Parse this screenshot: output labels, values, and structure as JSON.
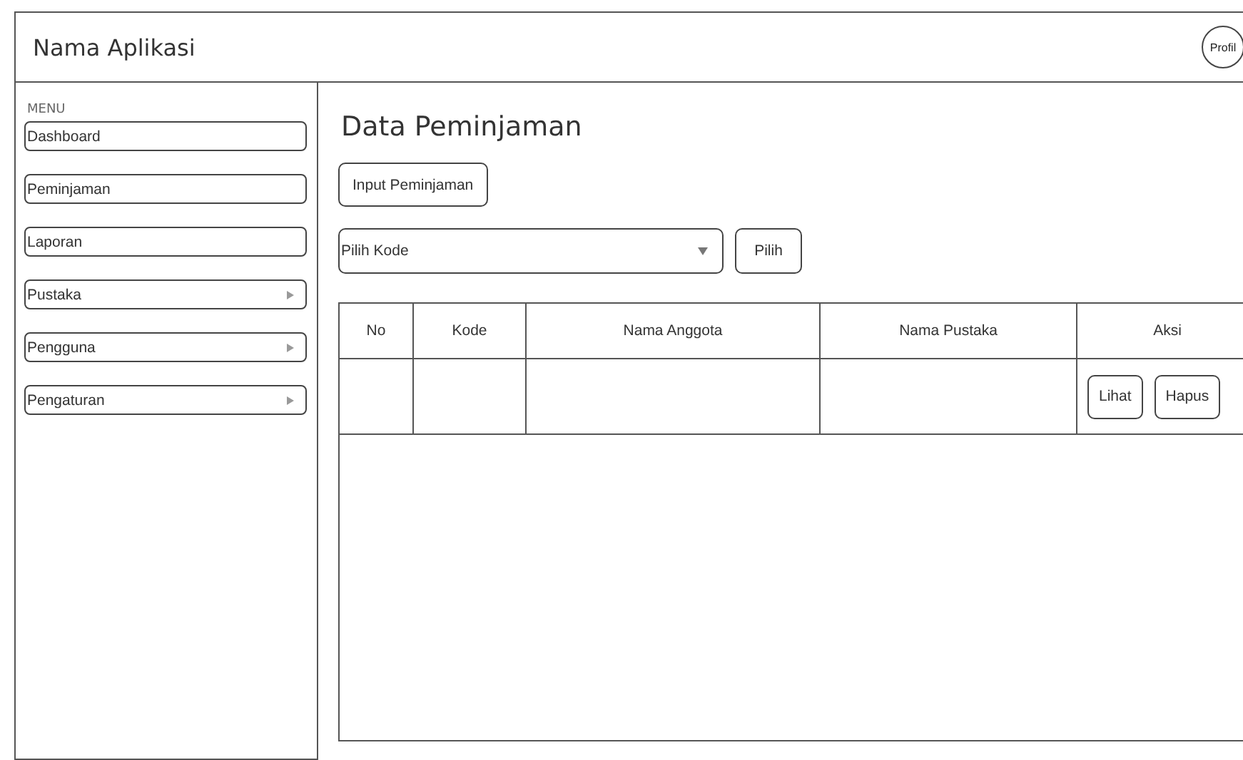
{
  "app_title": "Nama Aplikasi",
  "profile_label": "Profil",
  "menu": {
    "heading": "MENU",
    "items": [
      {
        "label": "Dashboard",
        "has_submenu": false
      },
      {
        "label": "Peminjaman",
        "has_submenu": false
      },
      {
        "label": "Laporan",
        "has_submenu": false
      },
      {
        "label": "Pustaka",
        "has_submenu": true
      },
      {
        "label": "Pengguna",
        "has_submenu": true
      },
      {
        "label": "Pengaturan",
        "has_submenu": true
      }
    ]
  },
  "page_title": "Data Peminjaman",
  "input_button": "Input Peminjaman",
  "select": {
    "value": "Pilih Kode"
  },
  "choose_button": "Pilih",
  "table": {
    "columns": [
      "No",
      "Kode",
      "Nama Anggota",
      "Nama Pustaka",
      "Aksi"
    ],
    "rows": [
      {
        "actions": [
          "Lihat",
          "Hapus"
        ]
      }
    ]
  }
}
